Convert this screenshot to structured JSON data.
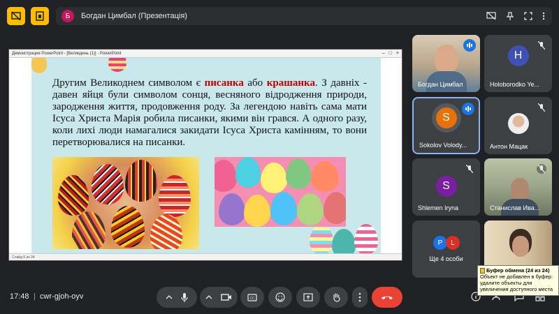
{
  "topbar": {
    "left_button_1_icon": "no-screen-icon",
    "left_button_2_icon": "present-icon",
    "presenter_initial": "Б",
    "presenter_label": "Богдан Цимбал (Презентація)"
  },
  "ppt": {
    "window_title": "Демонстрация PowerPoint - [Великдень (1)] - PowerPoint",
    "status_text": "Слайд 6 из 34",
    "slide": {
      "text_before": "Другим Великоднем символом є ",
      "highlight_1": "писанка",
      "text_middle": " або ",
      "highlight_2": "крашанка",
      "text_after": ". З давніх - давен яйця були символом сонця, весняного відродження природи, зародження життя, продовження роду. За легендою навіть сама мати Ісуса Христа Марія робила писанки, якими він грався. А одного разу, коли лихі люди намагалися закидати Ісуса Христа камінням, то вони перетворювалися на писанки."
    }
  },
  "participants": [
    {
      "name": "Богдан Цимбал",
      "type": "video",
      "speaking": true
    },
    {
      "name": "Holoborodko Ye...",
      "initial": "H",
      "color": "#3f51b5",
      "muted": true
    },
    {
      "name": "Sokolov Volody...",
      "initial": "S",
      "color": "#e8710a",
      "speaking": true,
      "active": true
    },
    {
      "name": "Антон Мацак",
      "type": "photo",
      "muted": true
    },
    {
      "name": "Shlemen Iryna",
      "initial": "S",
      "color": "#7b1fa2",
      "muted": true
    },
    {
      "name": "Станислав Ива...",
      "type": "video",
      "muted": true
    },
    {
      "name": "Ще 4 особи",
      "initials": [
        "P",
        "L"
      ]
    }
  ],
  "bottombar": {
    "time": "17:48",
    "separator": "|",
    "meeting_code": "cwr-gjoh-oyv"
  },
  "tooltip": {
    "title": "Буфер обмена (24 из 24)",
    "body": "Объект не добавлен в буфер: удалите объекты для увеличения доступного места"
  },
  "colors": {
    "background": "#202124",
    "accent_yellow": "#fbbc04",
    "end_call": "#ea4335",
    "active_border": "#8ab4f8"
  }
}
